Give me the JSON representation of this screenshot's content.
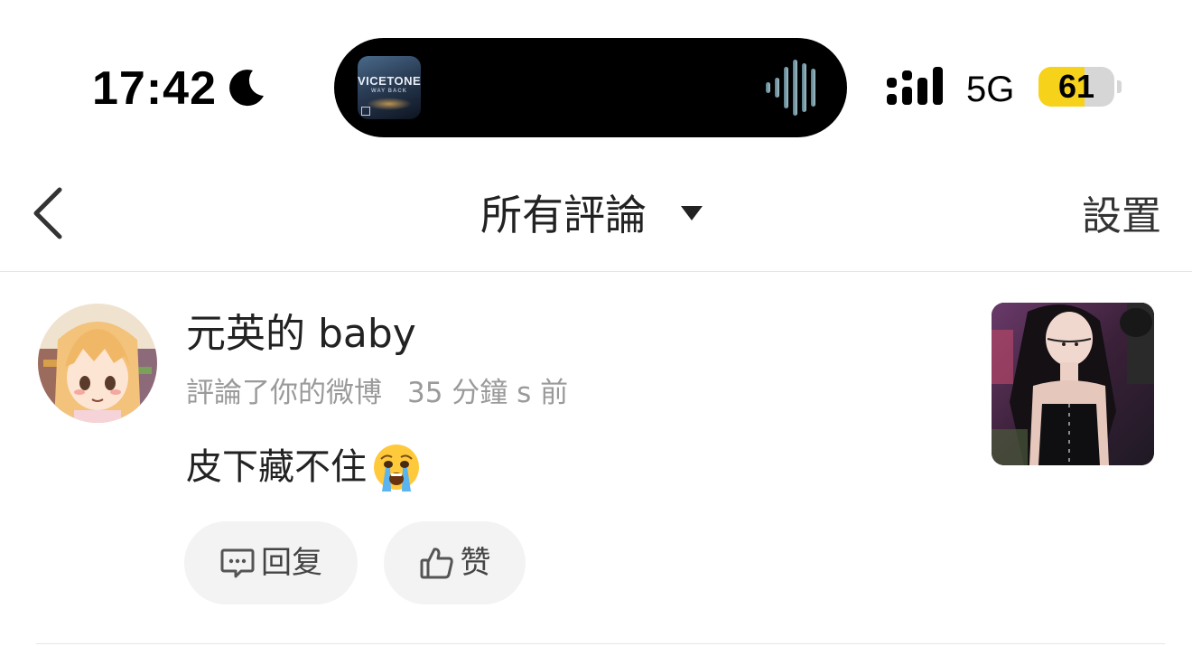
{
  "status_bar": {
    "time": "17:42",
    "network": "5G",
    "battery_percent": "61",
    "battery_level": 0.61,
    "focus_icon": "moon-icon",
    "signal_icon": "cellular-signal-icon"
  },
  "now_playing": {
    "album_title": "VICETONE",
    "album_subtitle": "WAY BACK",
    "waveform_icon": "audio-waveform-icon"
  },
  "nav": {
    "back_icon": "chevron-left-icon",
    "title": "所有評論",
    "dropdown_icon": "caret-down-icon",
    "settings_label": "設置"
  },
  "comment": {
    "username": "元英的 baby",
    "action": "評論了你的微博",
    "time": "35 分鐘 s 前",
    "text": "皮下藏不住",
    "emoji_icon": "loudly-crying-face-icon",
    "reply_label": "回复",
    "reply_icon": "comment-bubble-icon",
    "like_label": "赞",
    "like_icon": "thumbs-up-icon"
  },
  "colors": {
    "battery_fill": "#f7d21b",
    "meta_text": "#9a9a9a",
    "button_bg": "#f3f3f3"
  }
}
